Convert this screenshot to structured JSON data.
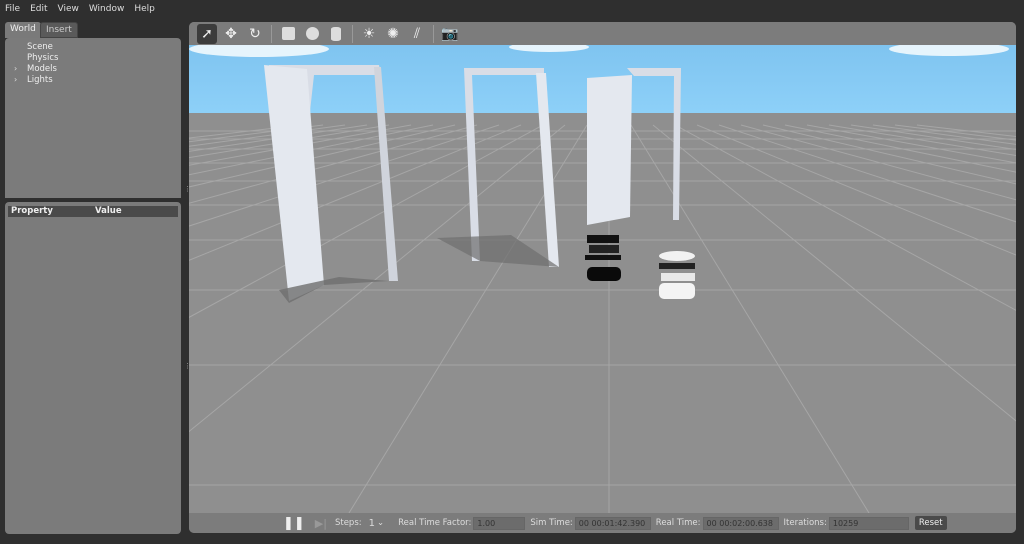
{
  "menu": [
    "File",
    "Edit",
    "View",
    "Window",
    "Help"
  ],
  "left_panel": {
    "tabs": [
      "World",
      "Insert"
    ],
    "tree": [
      {
        "label": "Scene",
        "expandable": false
      },
      {
        "label": "Physics",
        "expandable": false
      },
      {
        "label": "Models",
        "expandable": true
      },
      {
        "label": "Lights",
        "expandable": true
      }
    ],
    "property_header": {
      "property": "Property",
      "value": "Value"
    }
  },
  "toolbar": {
    "tools": [
      "select-arrow-icon",
      "translate-icon",
      "rotate-icon",
      "box-icon",
      "sphere-icon",
      "cylinder-icon",
      "point-light-icon",
      "spot-light-icon",
      "directional-light-icon",
      "screenshot-icon"
    ]
  },
  "bottom_bar": {
    "steps_label": "Steps:",
    "steps_value": "1",
    "rtf_label": "Real Time Factor:",
    "rtf_value": "1.00",
    "sim_time_label": "Sim Time:",
    "sim_time_value": "00 00:01:42.390",
    "real_time_label": "Real Time:",
    "real_time_value": "00 00:02:00.638",
    "iterations_label": "Iterations:",
    "iterations_value": "10259",
    "reset_label": "Reset"
  },
  "colors": {
    "sky": "#86c9f3",
    "floor": "#8f8f8f",
    "panel": "#7b7b7b",
    "background": "#2f2f2f"
  }
}
